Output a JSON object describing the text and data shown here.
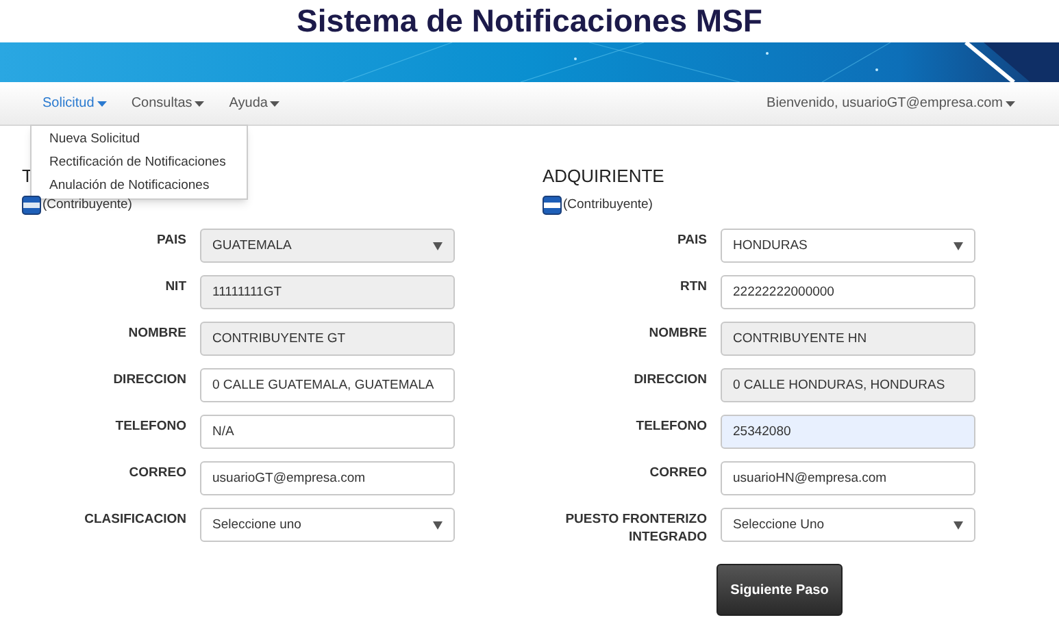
{
  "header": {
    "title": "Sistema de Notificaciones MSF"
  },
  "nav": {
    "menus": [
      {
        "label": "Solicitud",
        "selected": true
      },
      {
        "label": "Consultas",
        "selected": false
      },
      {
        "label": "Ayuda",
        "selected": false
      }
    ],
    "user": "Bienvenido, usuarioGT@empresa.com",
    "dropdown": [
      "Nueva Solicitud",
      "Rectificación de Notificaciones",
      "Anulación de Notificaciones"
    ]
  },
  "sections": [
    {
      "heading": "T",
      "subtitle": "(Contribuyente)",
      "fields": [
        {
          "label": "PAIS",
          "kind": "select",
          "value": "GUATEMALA",
          "readonly": true,
          "autofilled": false
        },
        {
          "label": "NIT",
          "kind": "input",
          "value": "11111111GT",
          "readonly": true,
          "autofilled": false
        },
        {
          "label": "NOMBRE",
          "kind": "input",
          "value": "CONTRIBUYENTE GT",
          "readonly": true,
          "autofilled": false
        },
        {
          "label": "DIRECCION",
          "kind": "input",
          "value": "0 CALLE GUATEMALA, GUATEMALA",
          "readonly": false,
          "autofilled": false
        },
        {
          "label": "TELEFONO",
          "kind": "input",
          "value": "N/A",
          "readonly": false,
          "autofilled": false
        },
        {
          "label": "CORREO",
          "kind": "input",
          "value": "usuarioGT@empresa.com",
          "readonly": false,
          "autofilled": false
        },
        {
          "label": "CLASIFICACION",
          "kind": "select",
          "value": "Seleccione uno",
          "readonly": false,
          "autofilled": false
        }
      ]
    },
    {
      "heading": "ADQUIRIENTE",
      "subtitle": "(Contribuyente)",
      "fields": [
        {
          "label": "PAIS",
          "kind": "select",
          "value": "HONDURAS",
          "readonly": false,
          "autofilled": false
        },
        {
          "label": "RTN",
          "kind": "input",
          "value": "22222222000000",
          "readonly": false,
          "autofilled": false
        },
        {
          "label": "NOMBRE",
          "kind": "input",
          "value": "CONTRIBUYENTE HN",
          "readonly": true,
          "autofilled": false
        },
        {
          "label": "DIRECCION",
          "kind": "input",
          "value": "0 CALLE HONDURAS, HONDURAS",
          "readonly": true,
          "autofilled": false
        },
        {
          "label": "TELEFONO",
          "kind": "input",
          "value": "25342080",
          "readonly": false,
          "autofilled": true
        },
        {
          "label": "CORREO",
          "kind": "input",
          "value": "usuarioHN@empresa.com",
          "readonly": false,
          "autofilled": false
        },
        {
          "label": "PUESTO FRONTERIZO INTEGRADO",
          "kind": "select",
          "value": "Seleccione Uno",
          "readonly": false,
          "autofilled": false
        }
      ]
    }
  ],
  "submit": "Siguiente Paso"
}
